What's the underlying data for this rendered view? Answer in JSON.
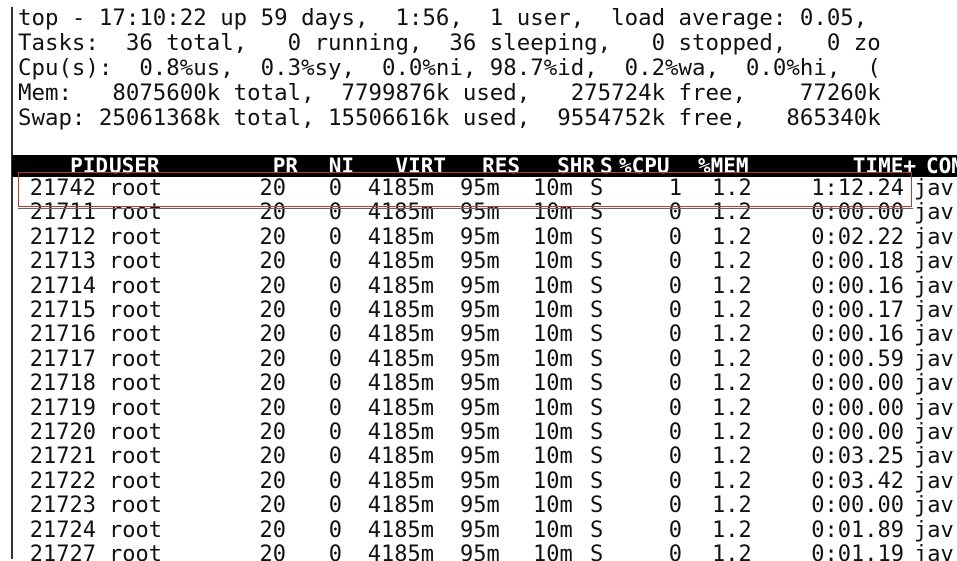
{
  "summary": {
    "line1": "top - 17:10:22 up 59 days,  1:56,  1 user,  load average: 0.05,",
    "line2": "Tasks:  36 total,   0 running,  36 sleeping,   0 stopped,   0 zo",
    "line3": "Cpu(s):  0.8%us,  0.3%sy,  0.0%ni, 98.7%id,  0.2%wa,  0.0%hi,  (",
    "line4": "Mem:   8075600k total,  7799876k used,   275724k free,    77260k",
    "line5": "Swap: 25061368k total, 15506616k used,  9554752k free,   865340k"
  },
  "table": {
    "headers": {
      "pid": "PID",
      "user": "USER",
      "pr": "PR",
      "ni": "NI",
      "virt": "VIRT",
      "res": "RES",
      "shr": "SHR",
      "s": "S",
      "cpu": "%CPU",
      "mem": "%MEM",
      "time": "TIME+",
      "cmd": "COM"
    },
    "rows": [
      {
        "pid": "21742",
        "user": "root",
        "pr": "20",
        "ni": "0",
        "virt": "4185m",
        "res": "95m",
        "shr": "10m",
        "s": "S",
        "cpu": "1",
        "mem": "1.2",
        "time": "1:12.24",
        "cmd": "jav"
      },
      {
        "pid": "21711",
        "user": "root",
        "pr": "20",
        "ni": "0",
        "virt": "4185m",
        "res": "95m",
        "shr": "10m",
        "s": "S",
        "cpu": "0",
        "mem": "1.2",
        "time": "0:00.00",
        "cmd": "jav"
      },
      {
        "pid": "21712",
        "user": "root",
        "pr": "20",
        "ni": "0",
        "virt": "4185m",
        "res": "95m",
        "shr": "10m",
        "s": "S",
        "cpu": "0",
        "mem": "1.2",
        "time": "0:02.22",
        "cmd": "jav"
      },
      {
        "pid": "21713",
        "user": "root",
        "pr": "20",
        "ni": "0",
        "virt": "4185m",
        "res": "95m",
        "shr": "10m",
        "s": "S",
        "cpu": "0",
        "mem": "1.2",
        "time": "0:00.18",
        "cmd": "jav"
      },
      {
        "pid": "21714",
        "user": "root",
        "pr": "20",
        "ni": "0",
        "virt": "4185m",
        "res": "95m",
        "shr": "10m",
        "s": "S",
        "cpu": "0",
        "mem": "1.2",
        "time": "0:00.16",
        "cmd": "jav"
      },
      {
        "pid": "21715",
        "user": "root",
        "pr": "20",
        "ni": "0",
        "virt": "4185m",
        "res": "95m",
        "shr": "10m",
        "s": "S",
        "cpu": "0",
        "mem": "1.2",
        "time": "0:00.17",
        "cmd": "jav"
      },
      {
        "pid": "21716",
        "user": "root",
        "pr": "20",
        "ni": "0",
        "virt": "4185m",
        "res": "95m",
        "shr": "10m",
        "s": "S",
        "cpu": "0",
        "mem": "1.2",
        "time": "0:00.16",
        "cmd": "jav"
      },
      {
        "pid": "21717",
        "user": "root",
        "pr": "20",
        "ni": "0",
        "virt": "4185m",
        "res": "95m",
        "shr": "10m",
        "s": "S",
        "cpu": "0",
        "mem": "1.2",
        "time": "0:00.59",
        "cmd": "jav"
      },
      {
        "pid": "21718",
        "user": "root",
        "pr": "20",
        "ni": "0",
        "virt": "4185m",
        "res": "95m",
        "shr": "10m",
        "s": "S",
        "cpu": "0",
        "mem": "1.2",
        "time": "0:00.00",
        "cmd": "jav"
      },
      {
        "pid": "21719",
        "user": "root",
        "pr": "20",
        "ni": "0",
        "virt": "4185m",
        "res": "95m",
        "shr": "10m",
        "s": "S",
        "cpu": "0",
        "mem": "1.2",
        "time": "0:00.00",
        "cmd": "jav"
      },
      {
        "pid": "21720",
        "user": "root",
        "pr": "20",
        "ni": "0",
        "virt": "4185m",
        "res": "95m",
        "shr": "10m",
        "s": "S",
        "cpu": "0",
        "mem": "1.2",
        "time": "0:00.00",
        "cmd": "jav"
      },
      {
        "pid": "21721",
        "user": "root",
        "pr": "20",
        "ni": "0",
        "virt": "4185m",
        "res": "95m",
        "shr": "10m",
        "s": "S",
        "cpu": "0",
        "mem": "1.2",
        "time": "0:03.25",
        "cmd": "jav"
      },
      {
        "pid": "21722",
        "user": "root",
        "pr": "20",
        "ni": "0",
        "virt": "4185m",
        "res": "95m",
        "shr": "10m",
        "s": "S",
        "cpu": "0",
        "mem": "1.2",
        "time": "0:03.42",
        "cmd": "jav"
      },
      {
        "pid": "21723",
        "user": "root",
        "pr": "20",
        "ni": "0",
        "virt": "4185m",
        "res": "95m",
        "shr": "10m",
        "s": "S",
        "cpu": "0",
        "mem": "1.2",
        "time": "0:00.00",
        "cmd": "jav"
      },
      {
        "pid": "21724",
        "user": "root",
        "pr": "20",
        "ni": "0",
        "virt": "4185m",
        "res": "95m",
        "shr": "10m",
        "s": "S",
        "cpu": "0",
        "mem": "1.2",
        "time": "0:01.89",
        "cmd": "jav"
      },
      {
        "pid": "21727",
        "user": "root",
        "pr": "20",
        "ni": "0",
        "virt": "4185m",
        "res": "95m",
        "shr": "10m",
        "s": "S",
        "cpu": "0",
        "mem": "1.2",
        "time": "0:01.19",
        "cmd": "jav"
      }
    ]
  },
  "colors": {
    "highlight": "#c0392b",
    "header_bg": "#000000",
    "header_fg": "#ffffff"
  }
}
